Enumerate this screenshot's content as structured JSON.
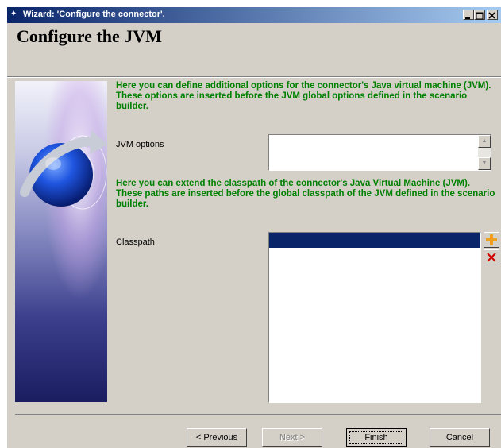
{
  "window": {
    "title": "Wizard: 'Configure the connector'.",
    "icon": "wizard-icon",
    "controls": [
      "minimize-icon",
      "maximize-icon",
      "close-icon"
    ]
  },
  "page": {
    "title": "Configure the JVM"
  },
  "jvm": {
    "description": "Here you can define additional options for the connector's Java virtual machine (JVM).\nThese options are inserted before the JVM global options defined in the scenario builder.",
    "label": "JVM options",
    "value": ""
  },
  "classpath": {
    "description": "Here you can extend the classpath of the connector's Java Virtual Machine (JVM).\nThese paths are inserted before the global classpath of the JVM defined in the scenario builder.",
    "label": "Classpath",
    "items": [
      ""
    ],
    "add_icon": "plus-icon",
    "remove_icon": "delete-x-icon"
  },
  "buttons": {
    "previous": "< Previous",
    "next": "Next >",
    "finish": "Finish",
    "cancel": "Cancel"
  },
  "colors": {
    "title_gradient_start": "#0a246a",
    "title_gradient_end": "#a6caf0",
    "description_text": "#008000",
    "selection": "#0a246a",
    "add_icon": "#f0a020",
    "remove_icon": "#d00000"
  }
}
